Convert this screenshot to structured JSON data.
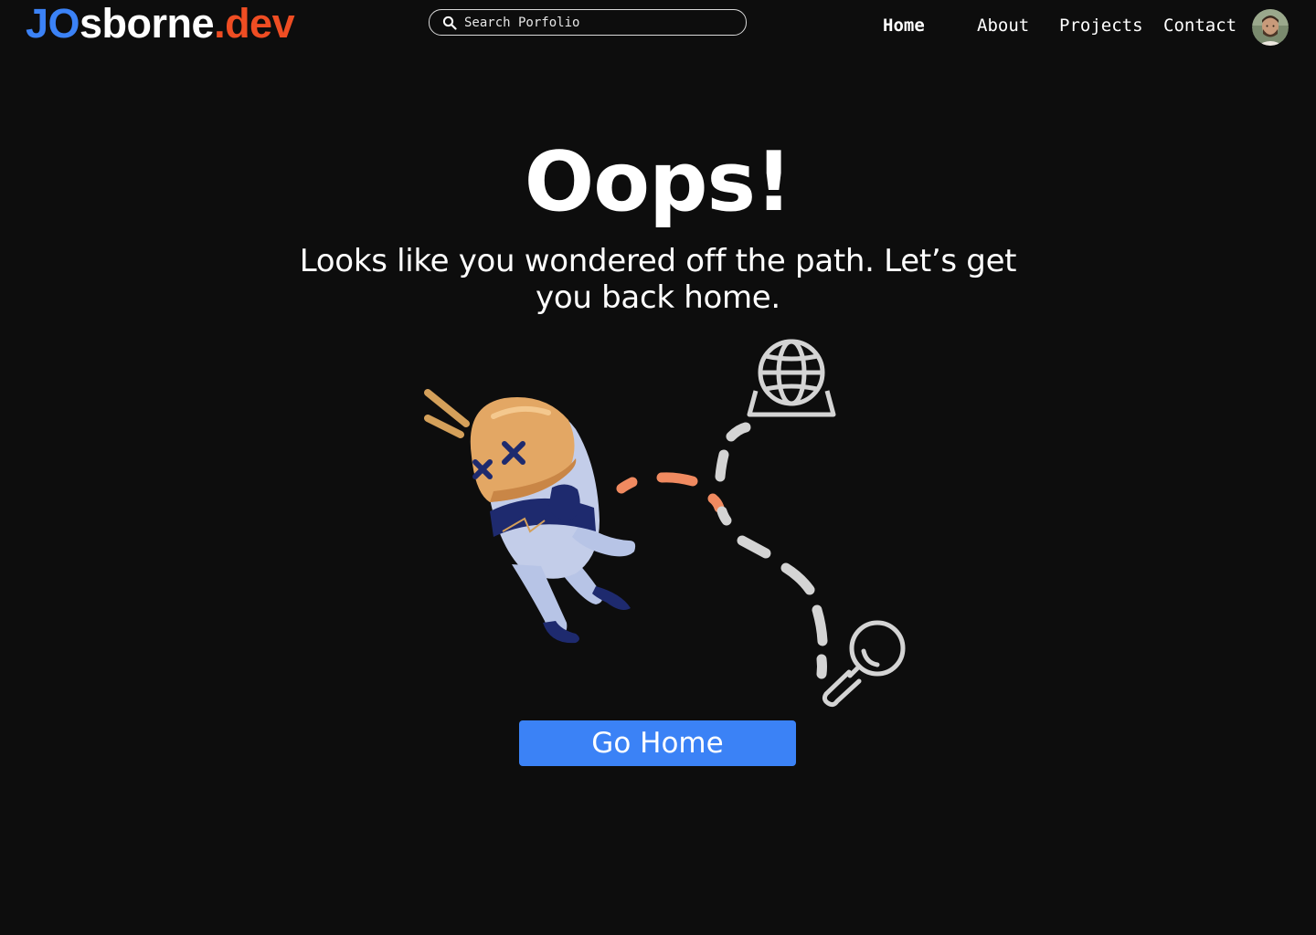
{
  "header": {
    "logo": {
      "part1": "JO",
      "part2": "sborne",
      "part3": ".dev"
    },
    "search": {
      "placeholder": "Search Porfolio",
      "icon": "search-icon"
    },
    "nav": [
      {
        "label": "Home",
        "active": true
      },
      {
        "label": "About",
        "active": false
      },
      {
        "label": "Projects",
        "active": false
      },
      {
        "label": "Contact",
        "active": false
      }
    ],
    "avatar": "profile-avatar"
  },
  "main": {
    "headline": "Oops!",
    "subtext": "Looks like you wondered off the path. Let’s get you back home.",
    "illustration": {
      "icons": [
        "lost-astronaut-icon",
        "globe-icon",
        "magnifying-glass-icon"
      ]
    },
    "cta_label": "Go Home"
  },
  "colors": {
    "background": "#0d0d0d",
    "accent_blue": "#3b82f6",
    "accent_orange": "#ef4d23",
    "path_orange": "#f08a60",
    "path_grey": "#d4d4d4"
  }
}
